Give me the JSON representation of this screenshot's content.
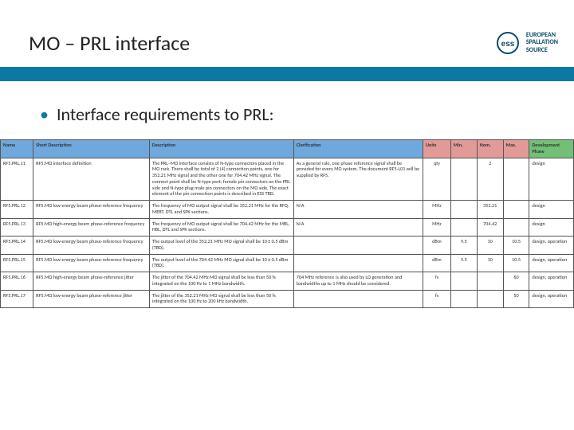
{
  "header": {
    "title": "MO – PRL interface",
    "logo_lines": [
      "EUROPEAN",
      "SPALLATION",
      "SOURCE"
    ]
  },
  "bullet": "Interface requirements to PRL:",
  "table": {
    "headers": [
      "Name",
      "Short Description",
      "Description",
      "Clarification",
      "Units",
      "Min.",
      "Nom.",
      "Max.",
      "Development Phase"
    ],
    "rows": [
      {
        "name": "RF5.PRL.11",
        "short": "RF5.MO interface definition",
        "desc": "The PRL–MO interface consists of N-type connectors placed in the MO rack. There shall be total of 2 (4) connection points, one for 352.21 MHz signal and the other one for 704.42 MHz signal. The connect point shall be N-type port: female pin connectors on the PRL side and N-type plug male pin connectors on the MO side. The exact element of the pin connection points is described in ESS TBD.",
        "clar": "As a general rule, one phase reference signal shall be provided for every MO system. The document RF5-L01 will be supplied by RF5.",
        "units": "qty",
        "min": "",
        "nom": "2",
        "max": "",
        "phase": "design"
      },
      {
        "name": "RF5.PRL.12",
        "short": "RF5.MO low-energy beam phase-reference frequency",
        "desc": "The frequency of MO output signal shall be 352.21 MHz for the RFQ, MEBT, DTL and SPK sections.",
        "clar": "N/A",
        "units": "MHz",
        "min": "",
        "nom": "352.21",
        "max": "",
        "phase": "design"
      },
      {
        "name": "RF5.PRL.13",
        "short": "RF5.MO high-energy beam phase-reference frequency",
        "desc": "The frequency of MO output signal shall be 704.42 MHz for the MBL, HBL, DTL and SPK sections.",
        "clar": "N/A",
        "units": "MHz",
        "min": "",
        "nom": "704.42",
        "max": "",
        "phase": "design"
      },
      {
        "name": "RF5.PRL.14",
        "short": "RF5.MO low-energy beam phase-reference frequency",
        "desc": "The output level of the 352.21 MHz MO signal shall be 10 ± 0.5 dBm (TBD).",
        "clar": "",
        "units": "dBm",
        "min": "9.5",
        "nom": "10",
        "max": "10.5",
        "phase": "design, operation"
      },
      {
        "name": "RF5.PRL.15",
        "short": "RF5.MO low-energy beam phase-reference frequency",
        "desc": "The output level of the 704.42 MHz MO signal shall be 10 ± 0.5 dBm (TBD).",
        "clar": "",
        "units": "dBm",
        "min": "9.5",
        "nom": "10",
        "max": "10.5",
        "phase": "design, operation"
      },
      {
        "name": "RF5.PRL.16",
        "short": "RF5.MO high-energy beam phase-reference jitter",
        "desc": "The jitter of the 704.42 MHz MO signal shall be less than 50 fs integrated on the 100 Hz to 1 MHz bandwidth.",
        "clar": "704 MHz reference is also used by LO generation and bandwidths up to 1 MHz should be considered.",
        "units": "fs",
        "min": "",
        "nom": "",
        "max": "60",
        "phase": "design, operation"
      },
      {
        "name": "RF5.PRL.17",
        "short": "RF5.MO low-energy beam phase-reference jitter",
        "desc": "The jitter of the 352.21 MHz MO signal shall be less than 50 fs integrated on the 100 Hz to 200 kHz bandwidth.",
        "clar": "",
        "units": "fs",
        "min": "",
        "nom": "",
        "max": "50",
        "phase": "design, operation"
      }
    ]
  }
}
